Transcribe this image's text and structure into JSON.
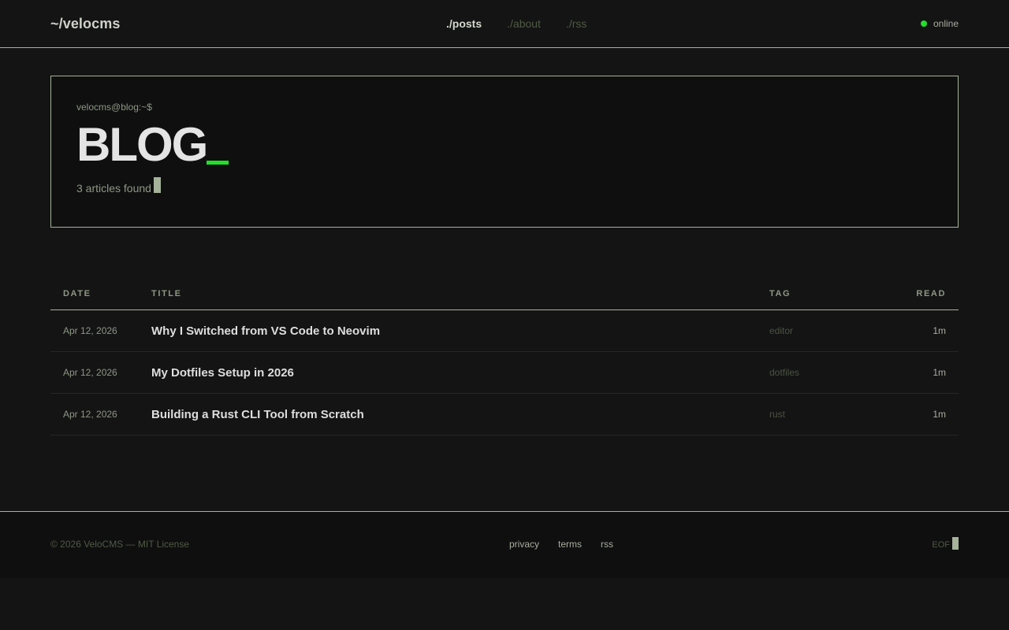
{
  "header": {
    "logo": "~/velocms",
    "nav": [
      {
        "label": "./posts",
        "active": true
      },
      {
        "label": "./about",
        "active": false
      },
      {
        "label": "./rss",
        "active": false
      }
    ],
    "status": {
      "label": "online",
      "color": "#22e02a"
    }
  },
  "hero": {
    "prompt": "velocms@blog:~$",
    "title": "BLOG",
    "underscore_color": "#22e02a",
    "count_text": "3 articles found"
  },
  "table": {
    "headers": {
      "date": "DATE",
      "title": "TITLE",
      "tag": "TAG",
      "read": "READ"
    },
    "rows": [
      {
        "date": "Apr 12, 2026",
        "title": "Why I Switched from VS Code to Neovim",
        "tag": "editor",
        "read": "1m"
      },
      {
        "date": "Apr 12, 2026",
        "title": "My Dotfiles Setup in 2026",
        "tag": "dotfiles",
        "read": "1m"
      },
      {
        "date": "Apr 12, 2026",
        "title": "Building a Rust CLI Tool from Scratch",
        "tag": "rust",
        "read": "1m"
      }
    ]
  },
  "footer": {
    "copyright": "© 2026 VeloCMS — MIT License",
    "links": [
      "privacy",
      "terms",
      "rss"
    ],
    "eof": "EOF"
  }
}
